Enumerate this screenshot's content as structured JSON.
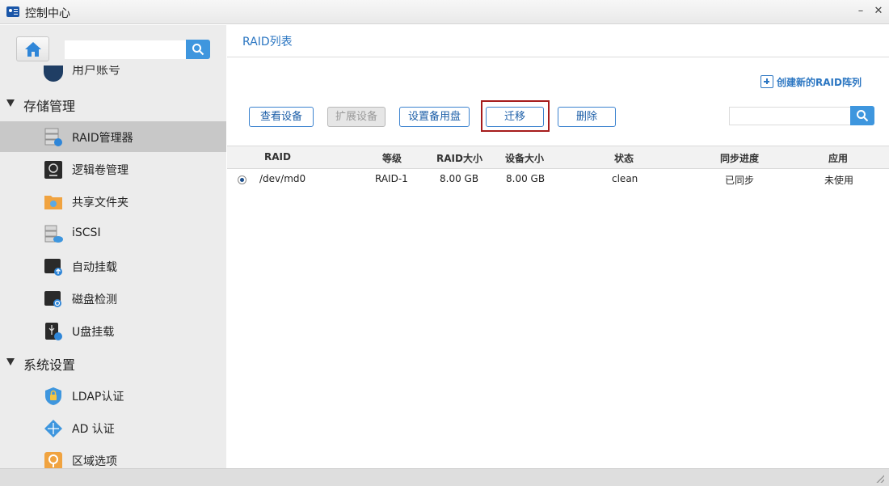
{
  "window": {
    "title": "控制中心",
    "minimize_icon": "minus-icon",
    "close_icon": "close-icon"
  },
  "sidebar": {
    "search_placeholder": "",
    "partial_item_label": "用户账号",
    "sections": [
      {
        "title": "存储管理",
        "items": [
          {
            "label": "RAID管理器",
            "icon": "raid-manager-icon",
            "active": true
          },
          {
            "label": "逻辑卷管理",
            "icon": "lvm-icon"
          },
          {
            "label": "共享文件夹",
            "icon": "shared-folder-icon"
          },
          {
            "label": "iSCSI",
            "icon": "iscsi-icon"
          },
          {
            "label": "自动挂载",
            "icon": "auto-mount-icon"
          },
          {
            "label": "磁盘检测",
            "icon": "disk-check-icon"
          },
          {
            "label": "U盘挂载",
            "icon": "usb-mount-icon"
          }
        ]
      },
      {
        "title": "系统设置",
        "items": [
          {
            "label": "LDAP认证",
            "icon": "ldap-shield-icon"
          },
          {
            "label": "AD 认证",
            "icon": "ad-network-icon"
          },
          {
            "label": "区域选项",
            "icon": "region-location-icon"
          }
        ]
      }
    ]
  },
  "main": {
    "title": "RAID列表",
    "create_link": "创建新的RAID阵列",
    "toolbar": {
      "view": "查看设备",
      "expand": "扩展设备",
      "spare": "设置备用盘",
      "migrate": "迁移",
      "delete": "删除"
    },
    "search_placeholder": "",
    "table": {
      "columns": [
        "RAID",
        "等级",
        "RAID大小",
        "设备大小",
        "状态",
        "同步进度",
        "应用"
      ],
      "rows": [
        {
          "raid": "/dev/md0",
          "level": "RAID-1",
          "raid_size": "8.00 GB",
          "device_size": "8.00 GB",
          "status": "clean",
          "sync": "已同步",
          "usage": "未使用",
          "selected": true
        }
      ]
    }
  },
  "colors": {
    "accent": "#3e96de",
    "link": "#2b76c2",
    "highlight_border": "#a61c1c",
    "sidebar_bg": "#ececec",
    "active_item_bg": "#c8c8c8"
  }
}
